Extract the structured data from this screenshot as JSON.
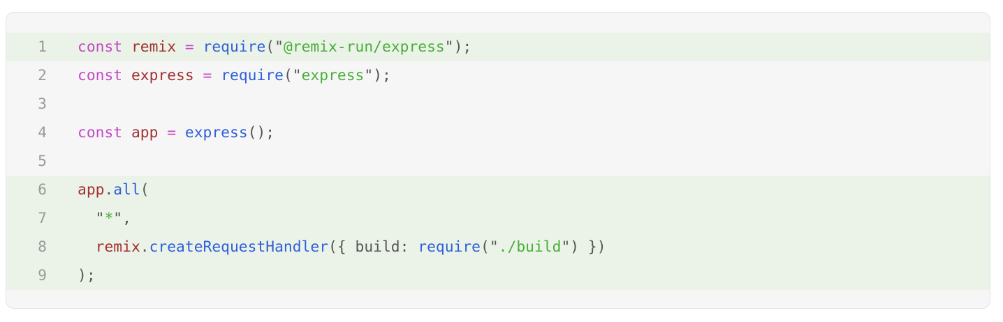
{
  "colors": {
    "keyword": "#c548c5",
    "variable": "#a3302f",
    "function": "#2f5fd9",
    "string": "#4aae3a",
    "punctuation": "#555555",
    "highlight": "#ebf3e8",
    "background": "#f6f6f6"
  },
  "lines": [
    {
      "number": "1",
      "highlight": true,
      "tokens": [
        [
          "kw",
          "const"
        ],
        [
          "p",
          " "
        ],
        [
          "var",
          "remix"
        ],
        [
          "p",
          " "
        ],
        [
          "op",
          "="
        ],
        [
          "p",
          " "
        ],
        [
          "fn",
          "require"
        ],
        [
          "p",
          "(\""
        ],
        [
          "str",
          "@remix-run/express"
        ],
        [
          "p",
          "\");"
        ]
      ]
    },
    {
      "number": "2",
      "highlight": false,
      "tokens": [
        [
          "kw",
          "const"
        ],
        [
          "p",
          " "
        ],
        [
          "var",
          "express"
        ],
        [
          "p",
          " "
        ],
        [
          "op",
          "="
        ],
        [
          "p",
          " "
        ],
        [
          "fn",
          "require"
        ],
        [
          "p",
          "(\""
        ],
        [
          "str",
          "express"
        ],
        [
          "p",
          "\");"
        ]
      ]
    },
    {
      "number": "3",
      "highlight": false,
      "tokens": []
    },
    {
      "number": "4",
      "highlight": false,
      "tokens": [
        [
          "kw",
          "const"
        ],
        [
          "p",
          " "
        ],
        [
          "var",
          "app"
        ],
        [
          "p",
          " "
        ],
        [
          "op",
          "="
        ],
        [
          "p",
          " "
        ],
        [
          "fn",
          "express"
        ],
        [
          "p",
          "();"
        ]
      ]
    },
    {
      "number": "5",
      "highlight": false,
      "tokens": []
    },
    {
      "number": "6",
      "highlight": true,
      "tokens": [
        [
          "var",
          "app"
        ],
        [
          "p",
          "."
        ],
        [
          "fn",
          "all"
        ],
        [
          "p",
          "("
        ]
      ]
    },
    {
      "number": "7",
      "highlight": true,
      "tokens": [
        [
          "p",
          "  \""
        ],
        [
          "str",
          "*"
        ],
        [
          "p",
          "\","
        ]
      ]
    },
    {
      "number": "8",
      "highlight": true,
      "tokens": [
        [
          "p",
          "  "
        ],
        [
          "var",
          "remix"
        ],
        [
          "p",
          "."
        ],
        [
          "fn",
          "createRequestHandler"
        ],
        [
          "p",
          "({ build: "
        ],
        [
          "fn",
          "require"
        ],
        [
          "p",
          "(\""
        ],
        [
          "str",
          "./build"
        ],
        [
          "p",
          "\") })"
        ]
      ]
    },
    {
      "number": "9",
      "highlight": true,
      "tokens": [
        [
          "p",
          ");"
        ]
      ]
    }
  ]
}
